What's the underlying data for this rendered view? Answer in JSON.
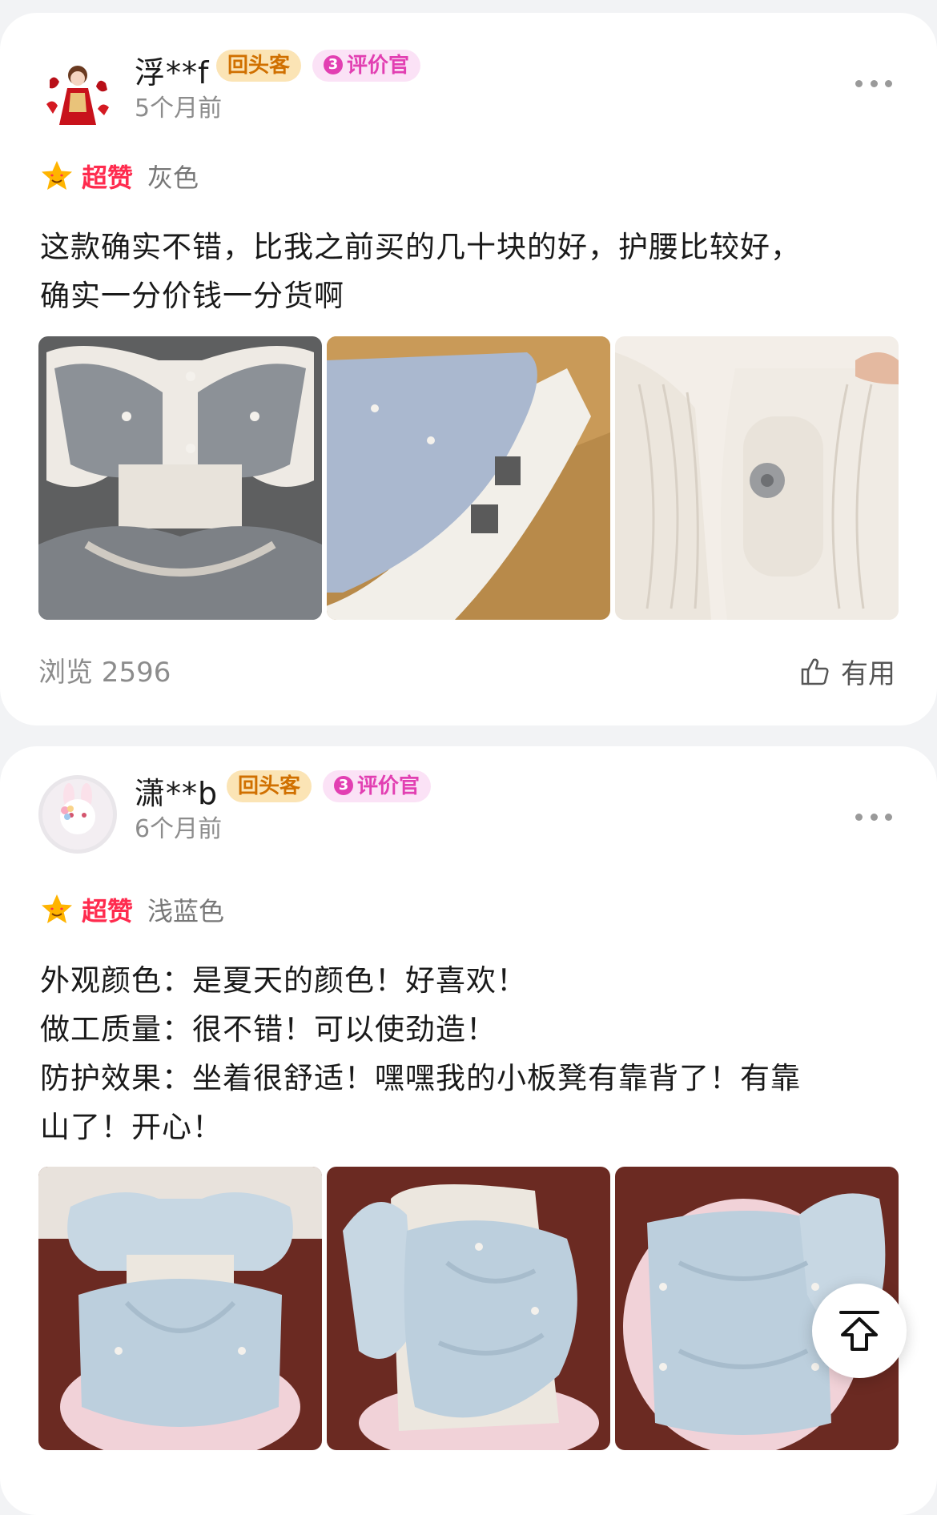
{
  "reviews": [
    {
      "username": "浮**f",
      "badge_repeat": "回头客",
      "badge_reviewer_level": "3",
      "badge_reviewer": "评价官",
      "time": "5个月前",
      "rating_label": "超赞",
      "variant": "灰色",
      "text_lines": [
        "这款确实不错，比我之前买的几十块的好，护腰比较好，",
        "确实一分价钱一分货啊"
      ],
      "views": "浏览 2596",
      "useful": "有用"
    },
    {
      "username": "潇**b",
      "badge_repeat": "回头客",
      "badge_reviewer_level": "3",
      "badge_reviewer": "评价官",
      "time": "6个月前",
      "rating_label": "超赞",
      "variant": "浅蓝色",
      "text_lines": [
        "外观颜色：是夏天的颜色！好喜欢！",
        "做工质量：很不错！可以使劲造！",
        "防护效果：坐着很舒适！嘿嘿我的小板凳有靠背了！有靠",
        "山了！开心！"
      ]
    }
  ],
  "colors": {
    "rating": "#ff2b4e",
    "repeat_badge": "#d07000",
    "reviewer_badge": "#e23fb2"
  },
  "icons": {
    "more": "more-dots-icon",
    "useful": "thumbs-up-icon",
    "back_to_top": "arrow-up-icon"
  }
}
